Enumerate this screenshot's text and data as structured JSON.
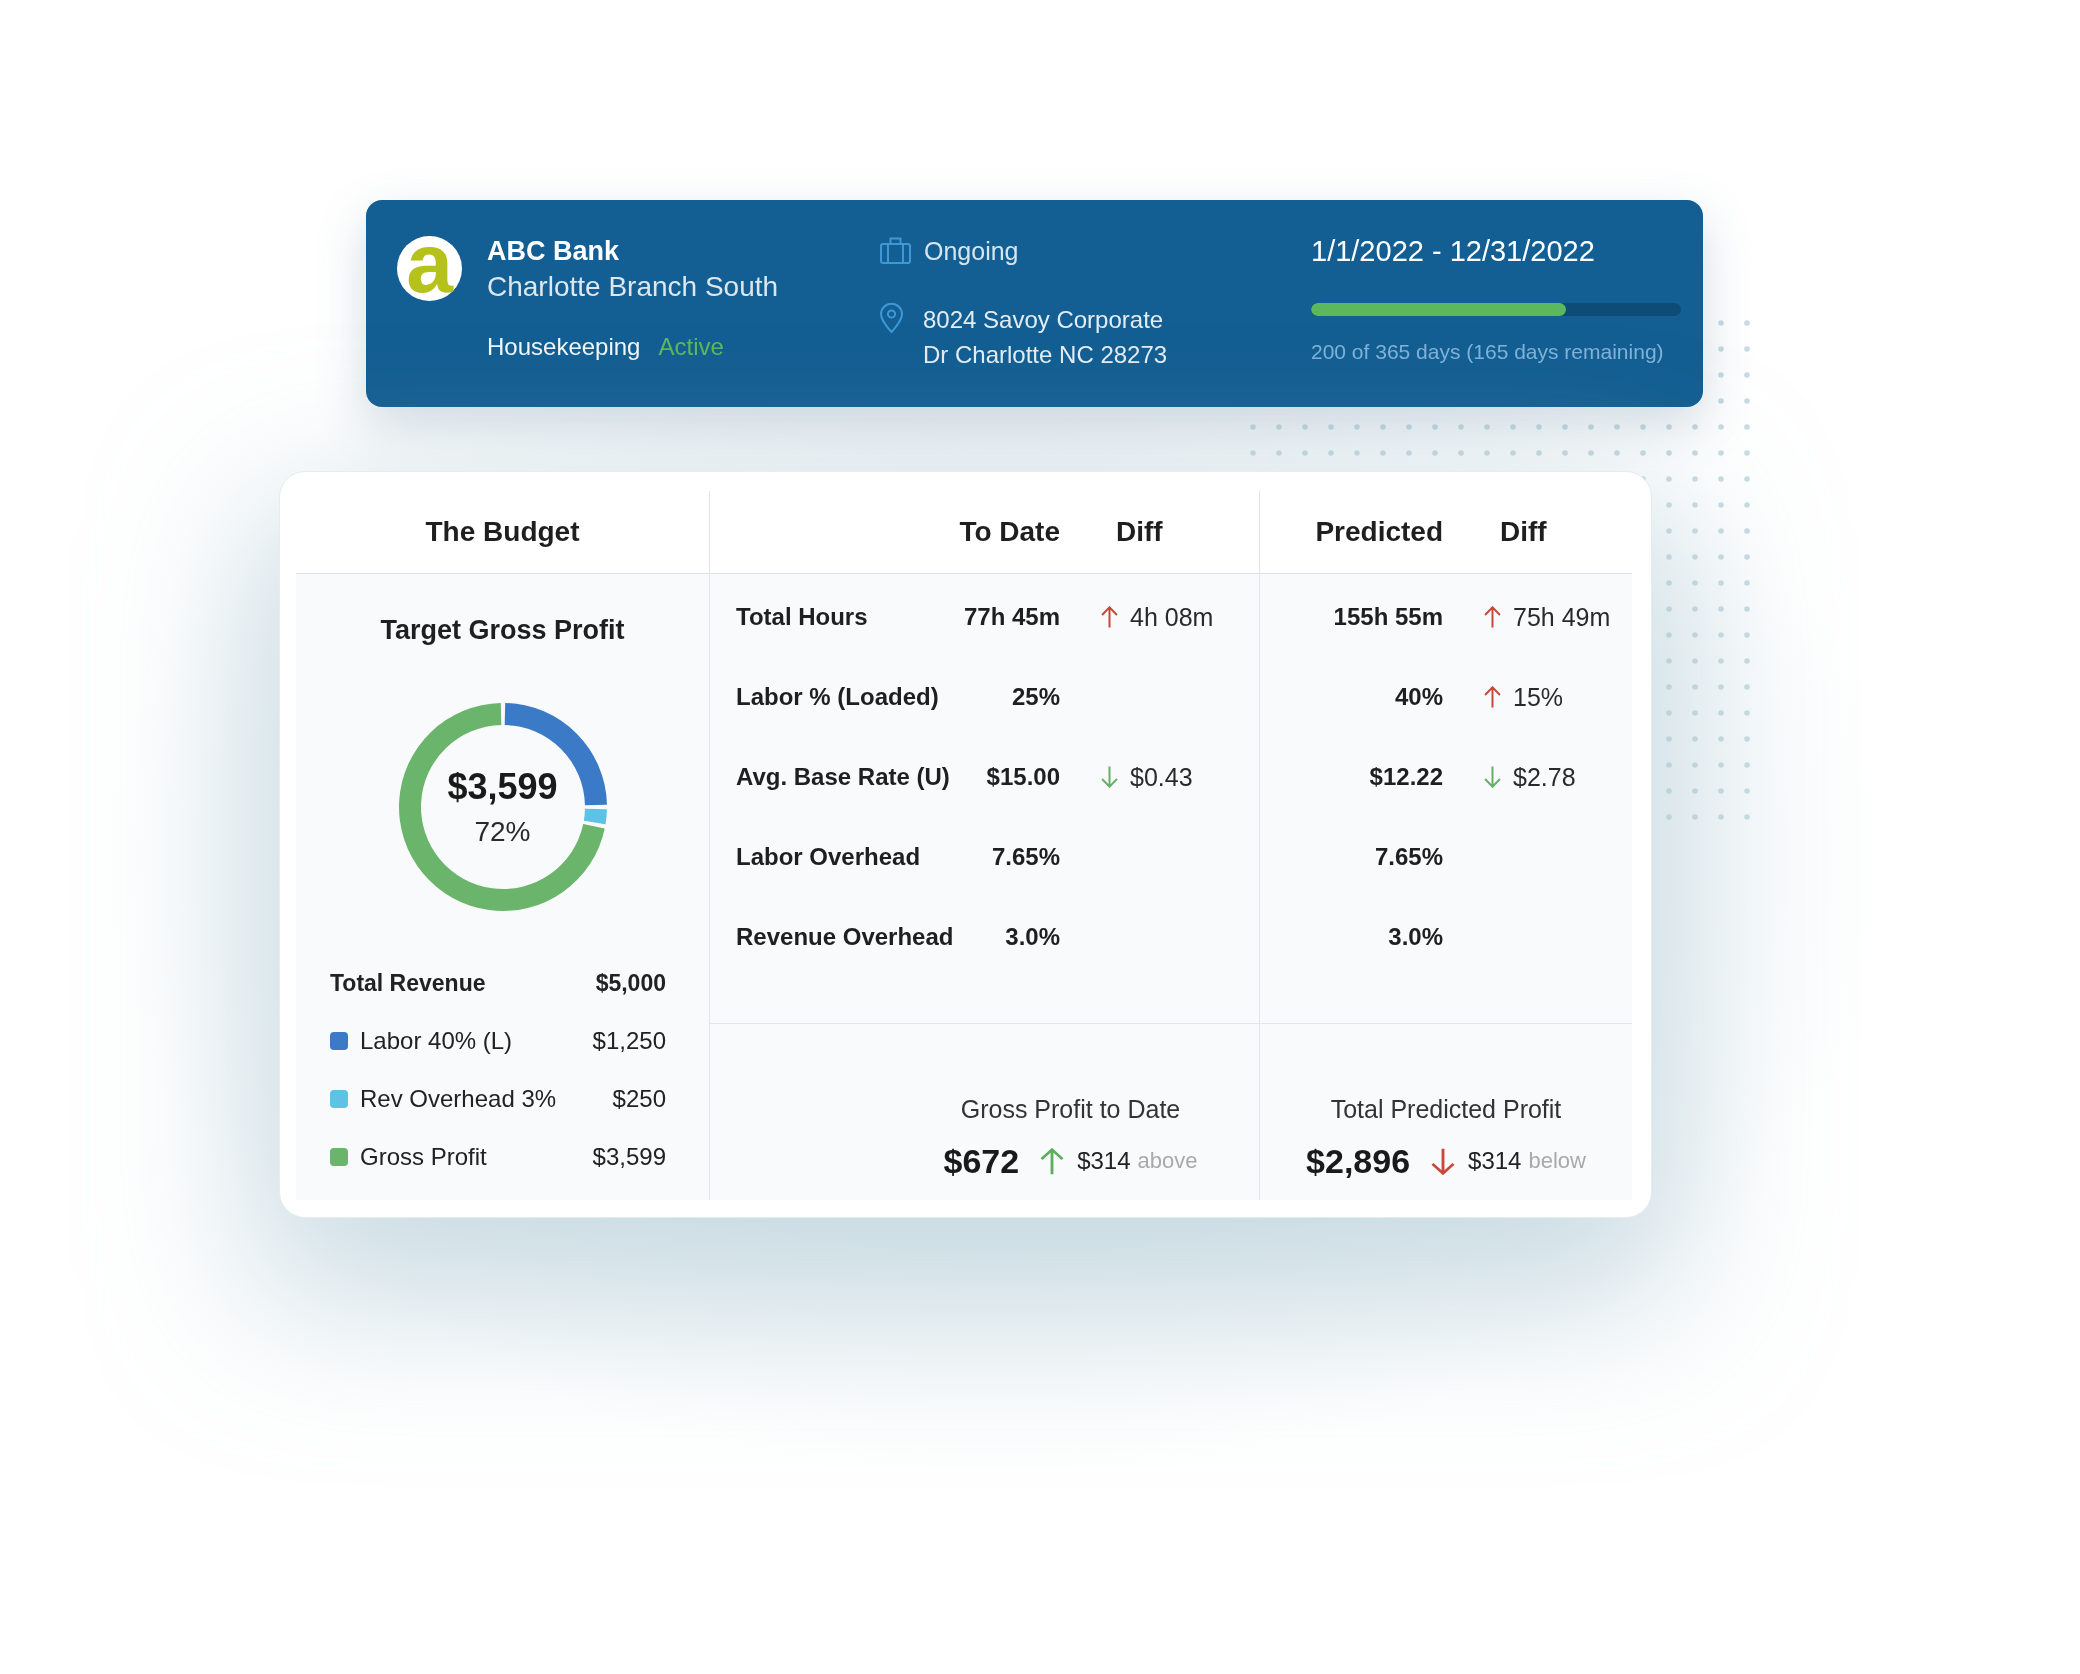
{
  "header": {
    "logo": {
      "letter": "a"
    },
    "company": "ABC Bank",
    "branch": "Charlotte Branch South",
    "department": "Housekeeping",
    "status": "Active",
    "project_status": "Ongoing",
    "address": "8024 Savoy Corporate Dr Charlotte NC 28273",
    "date_range": "1/1/2022 - 12/31/2022",
    "progress": {
      "level": 0.69,
      "caption": "200 of 365 days (165 days remaining)"
    }
  },
  "budget": {
    "title": "The Budget",
    "chart_title": "Target Gross Profit",
    "donut_center": {
      "amount": "$3,599",
      "percent": "72%"
    },
    "total": {
      "label": "Total Revenue",
      "amount": "$5,000"
    },
    "legend": [
      {
        "label": "Labor 40% (L)",
        "amount": "$1,250",
        "color": "#3b7ac6"
      },
      {
        "label": "Rev Overhead 3%",
        "amount": "$250",
        "color": "#5ec2e6"
      },
      {
        "label": "Gross Profit",
        "amount": "$3,599",
        "color": "#6ab56b"
      }
    ]
  },
  "to_date": {
    "columns": [
      "To Date",
      "Diff"
    ],
    "rows": [
      {
        "label": "Total Hours",
        "value": "77h 45m",
        "diff": {
          "value": "4h 08m",
          "kind": "up",
          "color": "#c9483b"
        }
      },
      {
        "label": "Labor % (Loaded)",
        "value": "25%"
      },
      {
        "label": "Avg. Base Rate (U)",
        "value": "$15.00",
        "diff": {
          "value": "$0.43",
          "kind": "down",
          "color": "#6aae6a"
        }
      },
      {
        "label": "Labor Overhead",
        "value": "7.65%"
      },
      {
        "label": "Revenue Overhead",
        "value": "3.0%"
      }
    ],
    "summary": {
      "title": "Gross Profit to Date",
      "amount": "$672",
      "change": {
        "kind": "up",
        "color": "#5fae5f",
        "value": "$314",
        "note": "above"
      }
    }
  },
  "predicted": {
    "columns": [
      "Predicted",
      "Diff"
    ],
    "rows": [
      {
        "value": "155h 55m",
        "diff": {
          "value": "75h 49m",
          "kind": "up",
          "color": "#c9483b"
        }
      },
      {
        "value": "40%",
        "diff": {
          "value": "15%",
          "kind": "up",
          "color": "#c9483b"
        }
      },
      {
        "value": "$12.22",
        "diff": {
          "value": "$2.78",
          "kind": "down",
          "color": "#6aae6a"
        }
      },
      {
        "value": "7.65%"
      },
      {
        "value": "3.0%"
      }
    ],
    "summary": {
      "title": "Total Predicted Profit",
      "amount": "$2,896",
      "change": {
        "kind": "down",
        "color": "#c9483b",
        "value": "$314",
        "note": "below"
      }
    }
  }
}
